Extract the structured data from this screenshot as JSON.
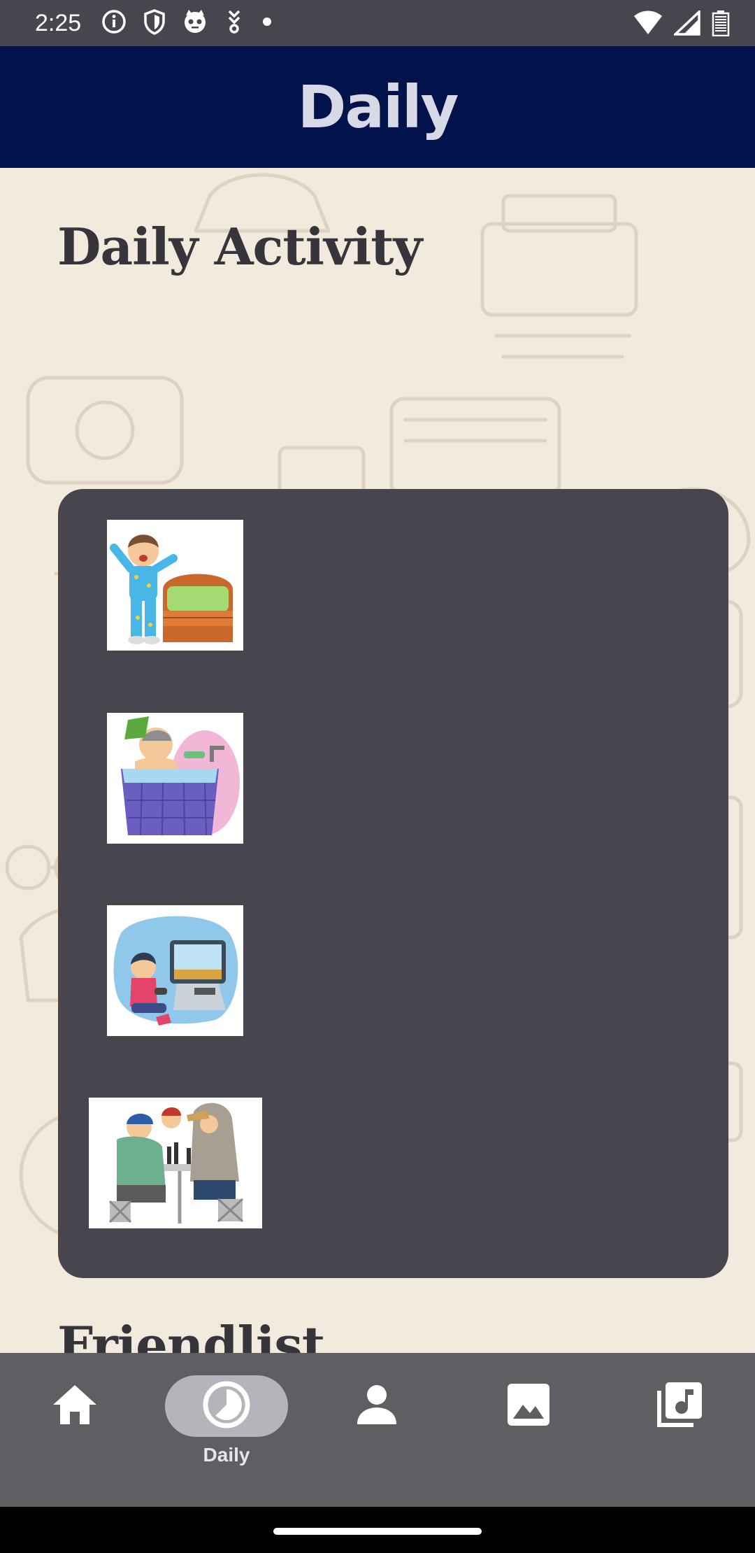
{
  "status_bar": {
    "time": "2:25",
    "icons_left": [
      "info-icon",
      "shield-icon",
      "cat-icon",
      "download-icon",
      "dot-icon"
    ],
    "icons_right": [
      "wifi-icon",
      "signal-icon",
      "battery-icon"
    ]
  },
  "app_bar": {
    "title": "Daily"
  },
  "sections": {
    "daily_activity_title": "Daily Activity",
    "friendlist_title": "Friendlist"
  },
  "activities": [
    {
      "image": "boy-waking-up-by-bed"
    },
    {
      "image": "boy-bathing-in-tub"
    },
    {
      "image": "boy-playing-video-games"
    },
    {
      "image": "friends-sitting-at-table"
    }
  ],
  "bottom_nav": {
    "items": [
      {
        "icon": "home-icon",
        "label": "",
        "active": false
      },
      {
        "icon": "clock-icon",
        "label": "Daily",
        "active": true
      },
      {
        "icon": "person-icon",
        "label": "",
        "active": false
      },
      {
        "icon": "image-icon",
        "label": "",
        "active": false
      },
      {
        "icon": "music-library-icon",
        "label": "",
        "active": false
      }
    ]
  },
  "colors": {
    "app_bar": "#02124A",
    "card": "#47464F",
    "nav": "#5E5E63",
    "background": "#F1EADD"
  }
}
